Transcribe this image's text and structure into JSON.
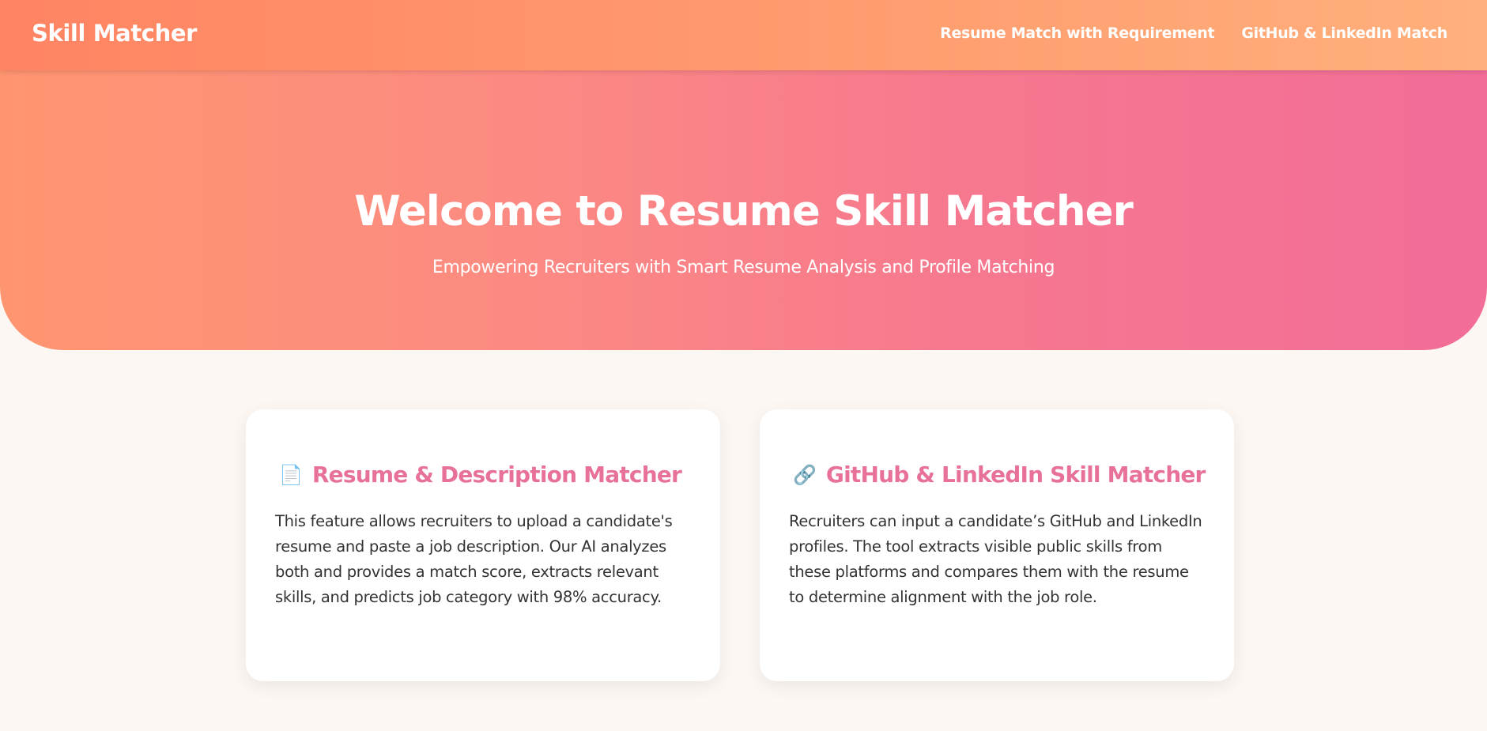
{
  "navbar": {
    "brand": "Skill Matcher",
    "links": [
      {
        "label": "Resume Match with Requirement"
      },
      {
        "label": "GitHub & LinkedIn Match"
      }
    ]
  },
  "hero": {
    "title": "Welcome to Resume Skill Matcher",
    "subtitle": "Empowering Recruiters with Smart Resume Analysis and Profile Matching"
  },
  "cards": [
    {
      "icon": "📄",
      "icon_name": "document-icon",
      "title": "Resume & Description Matcher",
      "description": "This feature allows recruiters to upload a candidate's resume and paste a job description. Our AI analyzes both and provides a match score, extracts relevant skills, and predicts job category with 98% accuracy."
    },
    {
      "icon": "🔗",
      "icon_name": "link-icon",
      "title": "GitHub & LinkedIn Skill Matcher",
      "description": "Recruiters can input a candidate’s GitHub and LinkedIn profiles. The tool extracts visible public skills from these platforms and compares them with the resume to determine alignment with the job role."
    }
  ],
  "colors": {
    "nav_gradient_start": "#ff8463",
    "nav_gradient_end": "#ffb07c",
    "hero_gradient_start": "#ff9570",
    "hero_gradient_end": "#f26d98",
    "card_title": "#e8719a",
    "page_background": "#fcf7f3"
  }
}
